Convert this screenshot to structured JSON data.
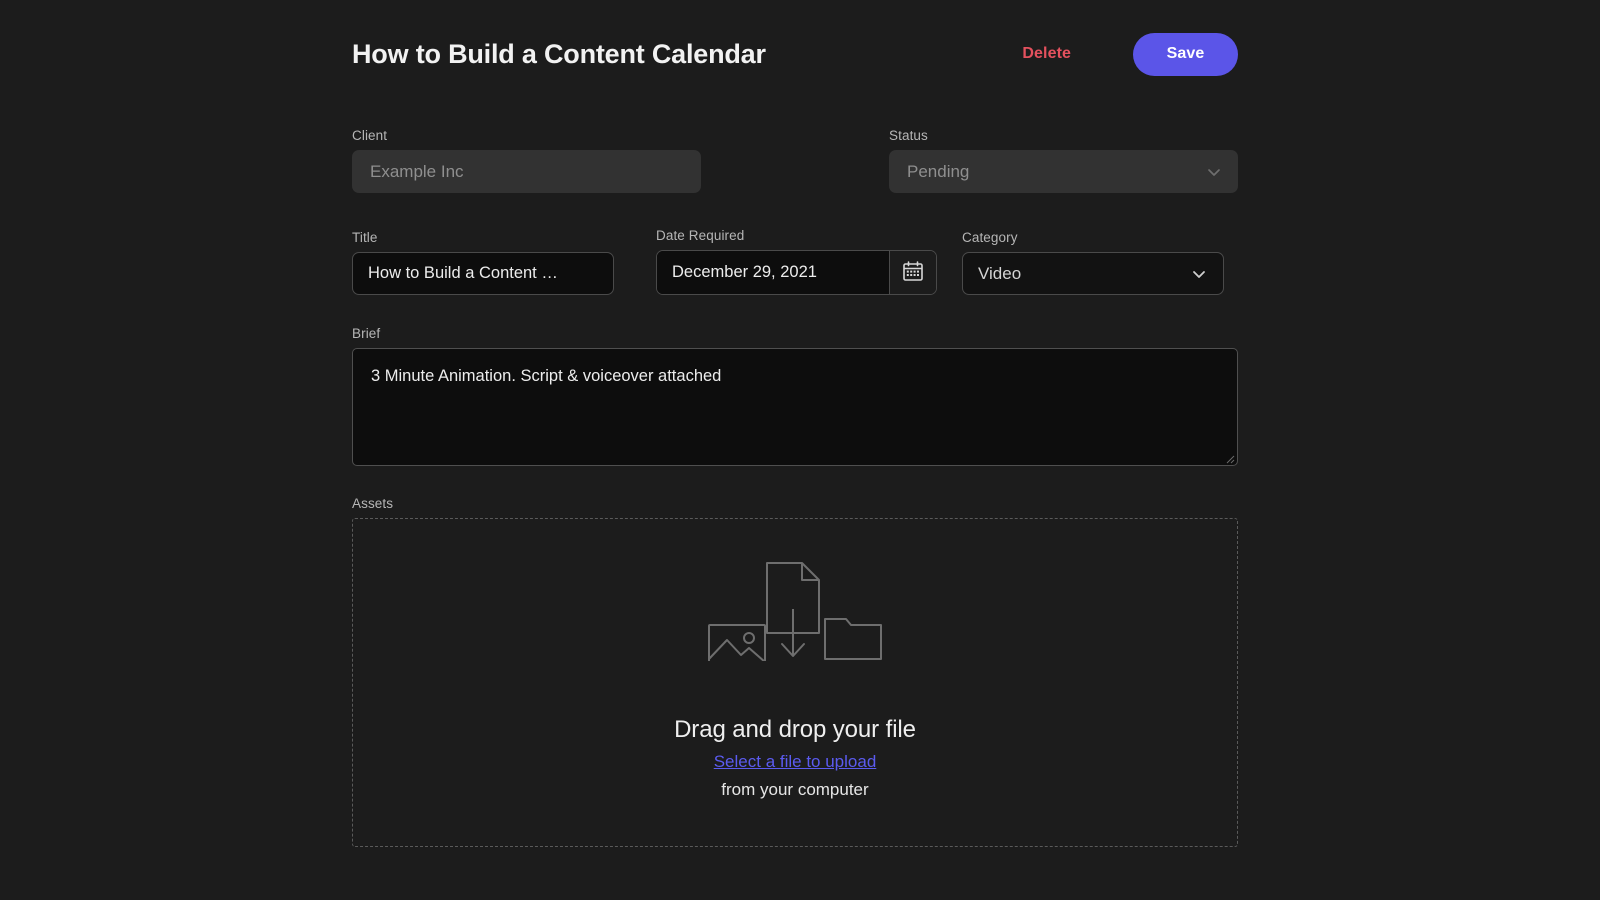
{
  "header": {
    "title": "How to Build a Content Calendar",
    "delete_label": "Delete",
    "save_label": "Save",
    "delete_color": "#e4515e",
    "save_bg": "#5b55e8"
  },
  "form": {
    "client": {
      "label": "Client",
      "placeholder": "Example Inc",
      "value": "",
      "disabled": true
    },
    "status": {
      "label": "Status",
      "value": "Pending",
      "options": [
        "Pending"
      ],
      "disabled": true,
      "icon": "chevron-down-icon"
    },
    "title": {
      "label": "Title",
      "value": "How to Build a Content …"
    },
    "date_required": {
      "label": "Date Required",
      "value": "December 29, 2021",
      "icon": "calendar-icon"
    },
    "category": {
      "label": "Category",
      "value": "Video",
      "options": [
        "Video"
      ],
      "icon": "chevron-down-icon"
    },
    "brief": {
      "label": "Brief",
      "value": "3 Minute Animation. Script & voiceover attached"
    },
    "assets": {
      "label": "Assets",
      "dropzone_title": "Drag and drop your file",
      "dropzone_link": "Select a file to upload",
      "dropzone_sub": "from your computer",
      "link_color": "#5b5bf0",
      "icons": [
        "image-icon",
        "file-download-icon",
        "folder-icon"
      ]
    }
  },
  "theme": {
    "page_bg": "#1c1c1c",
    "input_dark_bg": "#0d0d0d",
    "input_disabled_bg": "#323232",
    "border": "#4a4a4a"
  }
}
